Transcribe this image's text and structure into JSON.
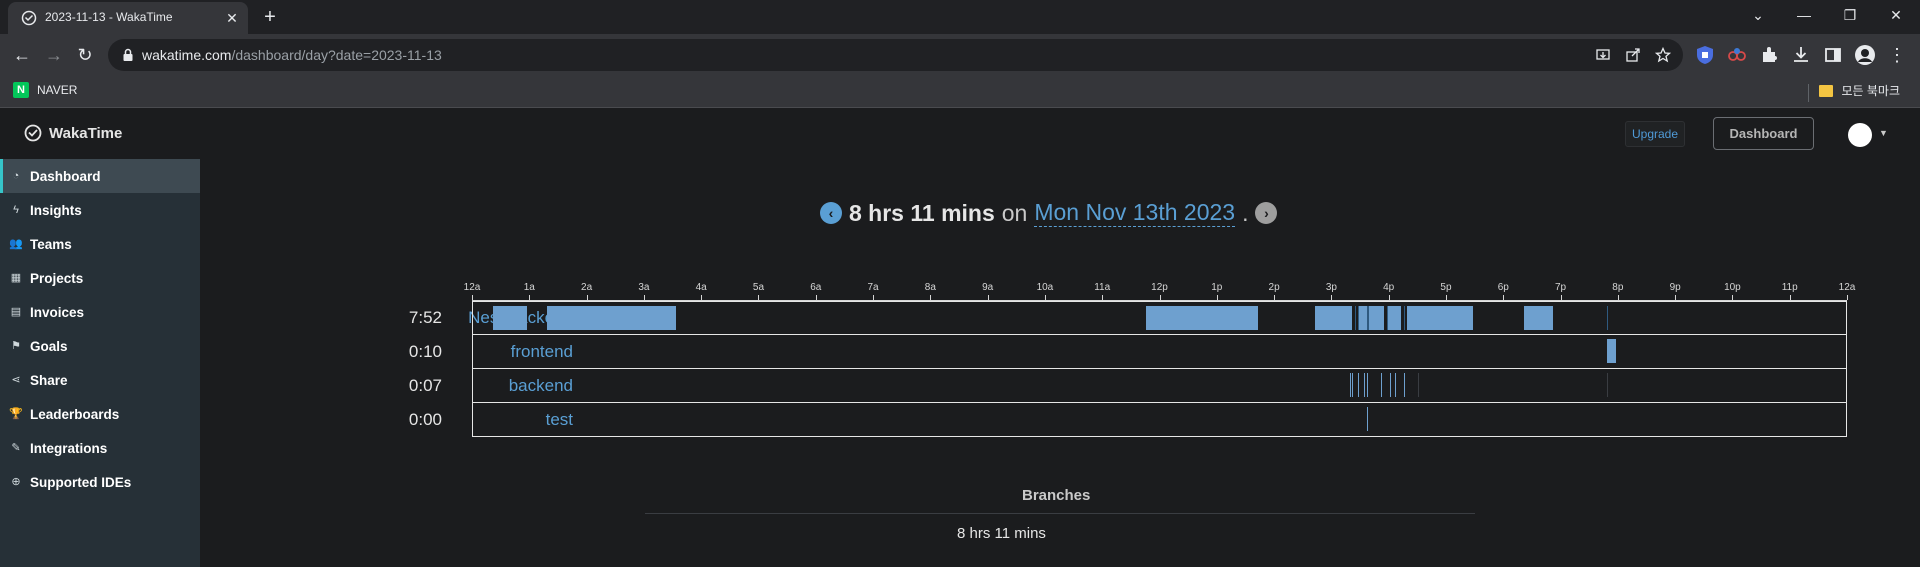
{
  "browser": {
    "tab_title": "2023-11-13 - WakaTime",
    "url_host": "wakatime.com",
    "url_path": "/dashboard/day?date=2023-11-13",
    "bookmarks": {
      "left": "NAVER",
      "naver_letter": "N",
      "right": "모든 북마크"
    }
  },
  "header": {
    "brand": "WakaTime",
    "upgrade_label": "Upgrade",
    "dashboard_label": "Dashboard"
  },
  "sidebar": {
    "items": [
      {
        "label": "Dashboard",
        "icon": "dashboard-icon",
        "active": true
      },
      {
        "label": "Insights",
        "icon": "bolt-icon"
      },
      {
        "label": "Teams",
        "icon": "users-icon"
      },
      {
        "label": "Projects",
        "icon": "grid-icon"
      },
      {
        "label": "Invoices",
        "icon": "file-icon"
      },
      {
        "label": "Goals",
        "icon": "flag-icon"
      },
      {
        "label": "Share",
        "icon": "share-icon"
      },
      {
        "label": "Leaderboards",
        "icon": "trophy-icon"
      },
      {
        "label": "Integrations",
        "icon": "wrench-icon"
      },
      {
        "label": "Supported IDEs",
        "icon": "plus-circle-icon"
      }
    ]
  },
  "summary": {
    "total": "8 hrs 11 mins",
    "on": "on",
    "date": "Mon Nov 13th 2023",
    "period": "."
  },
  "timeline": {
    "hour_labels": [
      "12a",
      "1a",
      "2a",
      "3a",
      "4a",
      "5a",
      "6a",
      "7a",
      "8a",
      "9a",
      "10a",
      "11a",
      "12p",
      "1p",
      "2p",
      "3p",
      "4p",
      "5p",
      "6p",
      "7p",
      "8p",
      "9p",
      "10p",
      "11p",
      "12a"
    ],
    "projects": [
      {
        "name": "Nest-backend",
        "time": "7:52"
      },
      {
        "name": "frontend",
        "time": "0:10"
      },
      {
        "name": "backend",
        "time": "0:07"
      },
      {
        "name": "test",
        "time": "0:00"
      }
    ],
    "accent": "#6ea0cf"
  },
  "branches": {
    "title": "Branches",
    "total": "8 hrs 11 mins"
  }
}
